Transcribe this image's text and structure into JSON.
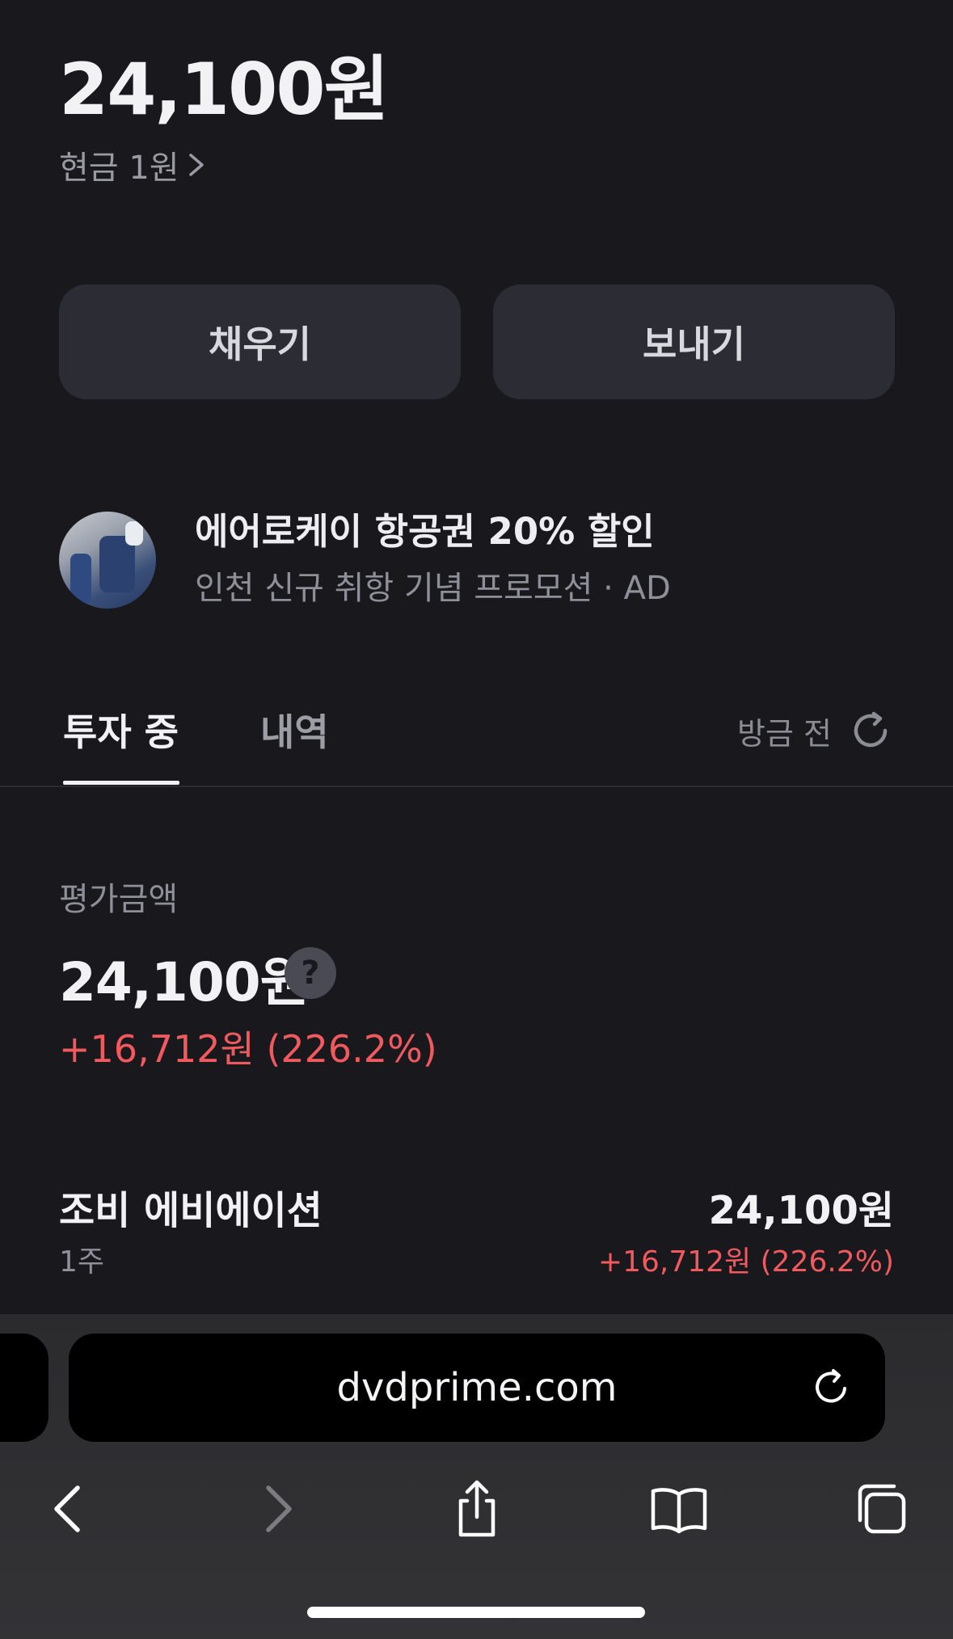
{
  "account": {
    "balance": "24,100원",
    "cash_label": "현금 1원"
  },
  "actions": {
    "fill_label": "채우기",
    "send_label": "보내기"
  },
  "promo": {
    "title": "에어로케이 항공권 20% 할인",
    "subtitle": "인천 신규 취항 기념 프로모션 · AD"
  },
  "tabs": {
    "items": [
      {
        "label": "투자 중",
        "active": true
      },
      {
        "label": "내역",
        "active": false
      }
    ],
    "refresh_label": "방금 전"
  },
  "valuation": {
    "label": "평가금액",
    "amount": "24,100원",
    "help_glyph": "?",
    "change": "+16,712원 (226.2%)"
  },
  "holding": {
    "name": "조비 에비에이션",
    "quantity": "1주",
    "value": "24,100원",
    "change": "+16,712원 (226.2%)"
  },
  "browser": {
    "url": "dvdprime.com",
    "toolbar_icons": [
      "back-icon",
      "forward-icon",
      "share-icon",
      "bookmarks-icon",
      "tabs-icon"
    ]
  },
  "colors": {
    "background": "#18181d",
    "button": "#2c2c35",
    "positive_change": "#f05a5f",
    "secondary_text": "#8f8f99"
  }
}
